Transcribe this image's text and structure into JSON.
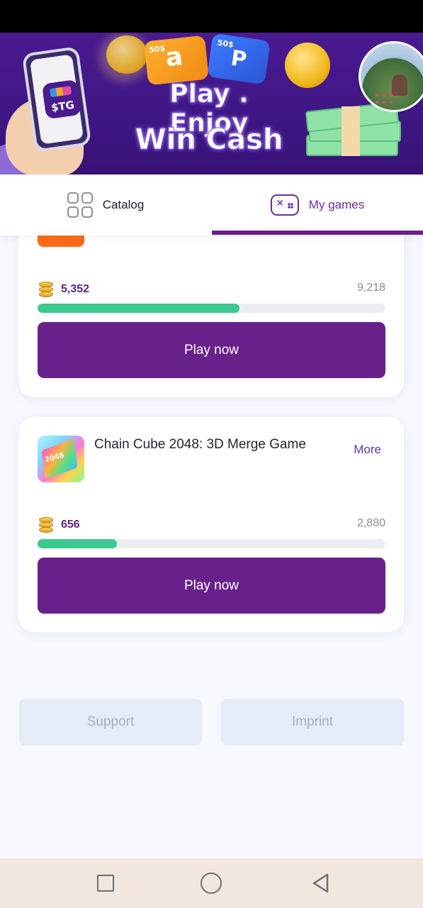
{
  "banner": {
    "tagline_line1": "Play . Enjoy",
    "tagline_line2": "Win Cash",
    "app_logo_text": "$TG",
    "amazon_card_amount": "50$",
    "amazon_card_logo": "a",
    "paypal_card_amount": "50$",
    "paypal_card_logo": "P"
  },
  "tabs": [
    {
      "label": "Catalog",
      "icon": "grid-icon",
      "active": false
    },
    {
      "label": "My games",
      "icon": "gamepad-icon",
      "active": true
    }
  ],
  "games": [
    {
      "title": "",
      "coins_earned": "5,352",
      "coins_target": "9,218",
      "progress_fraction": 0.58,
      "play_label": "Play now"
    },
    {
      "title": "Chain Cube 2048: 3D Merge Game",
      "more_label": "More",
      "thumb_text": "2048",
      "coins_earned": "656",
      "coins_target": "2,880",
      "progress_fraction": 0.228,
      "play_label": "Play now"
    }
  ],
  "footer": {
    "support_label": "Support",
    "imprint_label": "Imprint"
  },
  "navbar": {
    "icons": [
      "recent-apps-icon",
      "home-icon",
      "back-icon"
    ]
  },
  "colors": {
    "accent": "#68218a",
    "progress": "#3cc98f",
    "banner": "#4a1a8f"
  }
}
